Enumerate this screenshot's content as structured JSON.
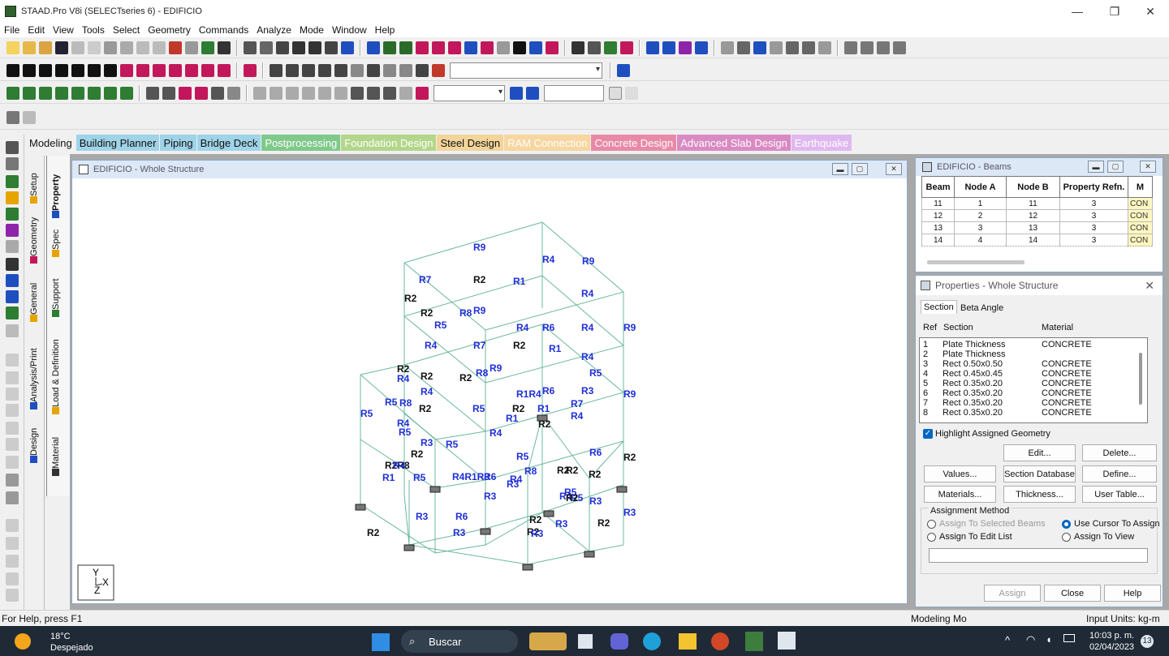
{
  "window": {
    "title": "STAAD.Pro V8i (SELECTseries 6) - EDIFICIO",
    "minimize": "—",
    "restore": "❐",
    "close": "✕"
  },
  "menu": [
    "File",
    "Edit",
    "View",
    "Tools",
    "Select",
    "Geometry",
    "Commands",
    "Analyze",
    "Mode",
    "Window",
    "Help"
  ],
  "mode_tabs": [
    {
      "label": "Modeling",
      "bg": "#f0f0f0",
      "color": "#111111"
    },
    {
      "label": "Building Planner",
      "bg": "#9fd3e8",
      "color": "#111111"
    },
    {
      "label": "Piping",
      "bg": "#9fd3e8",
      "color": "#111111"
    },
    {
      "label": "Bridge Deck",
      "bg": "#9fd3e8",
      "color": "#111111"
    },
    {
      "label": "Postprocessing",
      "bg": "#7fc98a",
      "color": "#ffffff"
    },
    {
      "label": "Foundation Design",
      "bg": "#b3d68a",
      "color": "#ffffff"
    },
    {
      "label": "Steel Design",
      "bg": "#f3d59a",
      "color": "#111111"
    },
    {
      "label": "RAM Connection",
      "bg": "#f7d6a0",
      "color": "#ffffff"
    },
    {
      "label": "Concrete Design",
      "bg": "#e88aa6",
      "color": "#ffffff"
    },
    {
      "label": "Advanced Slab Design",
      "bg": "#d98ac3",
      "color": "#ffffff"
    },
    {
      "label": "Earthquake",
      "bg": "#e0b8f0",
      "color": "#ffffff"
    }
  ],
  "page_tabs": {
    "general": "General",
    "setup": "Setup",
    "geometry": "Geometry",
    "property": "Property",
    "spec": "Spec",
    "support": "Support",
    "load": "Load & Definition",
    "analysis": "Analysis/Print",
    "design": "Design",
    "material": "Material"
  },
  "structure_window": {
    "title": "EDIFICIO - Whole Structure",
    "axis_y": "Y",
    "axis_x": "X",
    "axis_z": "Z"
  },
  "structure_labels": [
    "R9",
    "R4",
    "R9",
    "R7",
    "R2",
    "R1",
    "R4",
    "R2",
    "R2",
    "R8",
    "R9",
    "R5",
    "R4",
    "R6",
    "R4",
    "R9",
    "R4",
    "R7",
    "R2",
    "R1",
    "R4",
    "R2",
    "R2",
    "R5",
    "R4",
    "R2",
    "R8",
    "R9",
    "R4",
    "R1R4",
    "R6",
    "R3",
    "R9",
    "R5",
    "R8",
    "R2",
    "R7",
    "R5",
    "R2",
    "R1",
    "R1",
    "R5",
    "R4",
    "R2",
    "R4",
    "R5",
    "R4",
    "R3",
    "R5",
    "R6",
    "R2",
    "R5",
    "R2",
    "R2R8",
    "R4",
    "R4R1R3",
    "R6",
    "R4",
    "R8",
    "R2",
    "R2",
    "R4",
    "R1",
    "R5",
    "R3",
    "R5",
    "R5",
    "R2",
    "R3",
    "R3",
    "R6",
    "R2",
    "R3",
    "R2",
    "R3",
    "R2",
    "R3",
    "R2",
    "R3",
    "R2",
    "R3"
  ],
  "beams_window": {
    "title": "EDIFICIO - Beams",
    "columns": [
      "Beam",
      "Node A",
      "Node B",
      "Property Refn.",
      "M"
    ],
    "rows": [
      [
        "11",
        "1",
        "11",
        "3",
        "CON"
      ],
      [
        "12",
        "2",
        "12",
        "3",
        "CON"
      ],
      [
        "13",
        "3",
        "13",
        "3",
        "CON"
      ],
      [
        "14",
        "4",
        "14",
        "3",
        "CON"
      ]
    ]
  },
  "properties": {
    "title": "Properties - Whole Structure",
    "tabs": [
      "Section",
      "Beta Angle"
    ],
    "headers": {
      "ref": "Ref",
      "section": "Section",
      "material": "Material"
    },
    "sections": [
      {
        "ref": "1",
        "section": "Plate Thickness",
        "material": "CONCRETE"
      },
      {
        "ref": "2",
        "section": "Plate Thickness",
        "material": ""
      },
      {
        "ref": "3",
        "section": "Rect 0.50x0.50",
        "material": "CONCRETE"
      },
      {
        "ref": "4",
        "section": "Rect 0.45x0.45",
        "material": "CONCRETE"
      },
      {
        "ref": "5",
        "section": "Rect 0.35x0.20",
        "material": "CONCRETE"
      },
      {
        "ref": "6",
        "section": "Rect 0.35x0.20",
        "material": "CONCRETE"
      },
      {
        "ref": "7",
        "section": "Rect 0.35x0.20",
        "material": "CONCRETE"
      },
      {
        "ref": "8",
        "section": "Rect 0.35x0.20",
        "material": "CONCRETE"
      }
    ],
    "highlight": "Highlight Assigned Geometry",
    "buttons": {
      "edit": "Edit...",
      "delete": "Delete...",
      "values": "Values...",
      "section_db": "Section Database",
      "define": "Define...",
      "materials": "Materials...",
      "thickness": "Thickness...",
      "user_table": "User Table..."
    },
    "assignment_method": "Assignment Method",
    "methods": {
      "selected": "Assign To Selected Beams",
      "cursor": "Use Cursor To Assign",
      "edit_list": "Assign To Edit List",
      "view": "Assign To View"
    },
    "assign": "Assign",
    "close": "Close",
    "help": "Help"
  },
  "status": {
    "help": "For Help, press F1",
    "mode": "Modeling Mo",
    "units": "Input Units:  kg-m"
  },
  "taskbar": {
    "temp": "18°C",
    "weather": "Despejado",
    "search": "Buscar",
    "time": "10:03 p. m.",
    "date": "02/04/2023",
    "badge": "13"
  },
  "colors": {
    "label_blue": "#1f2fd6",
    "label_black": "#111111",
    "frame_green": "#6bb89f",
    "accent": "#0067c0"
  }
}
